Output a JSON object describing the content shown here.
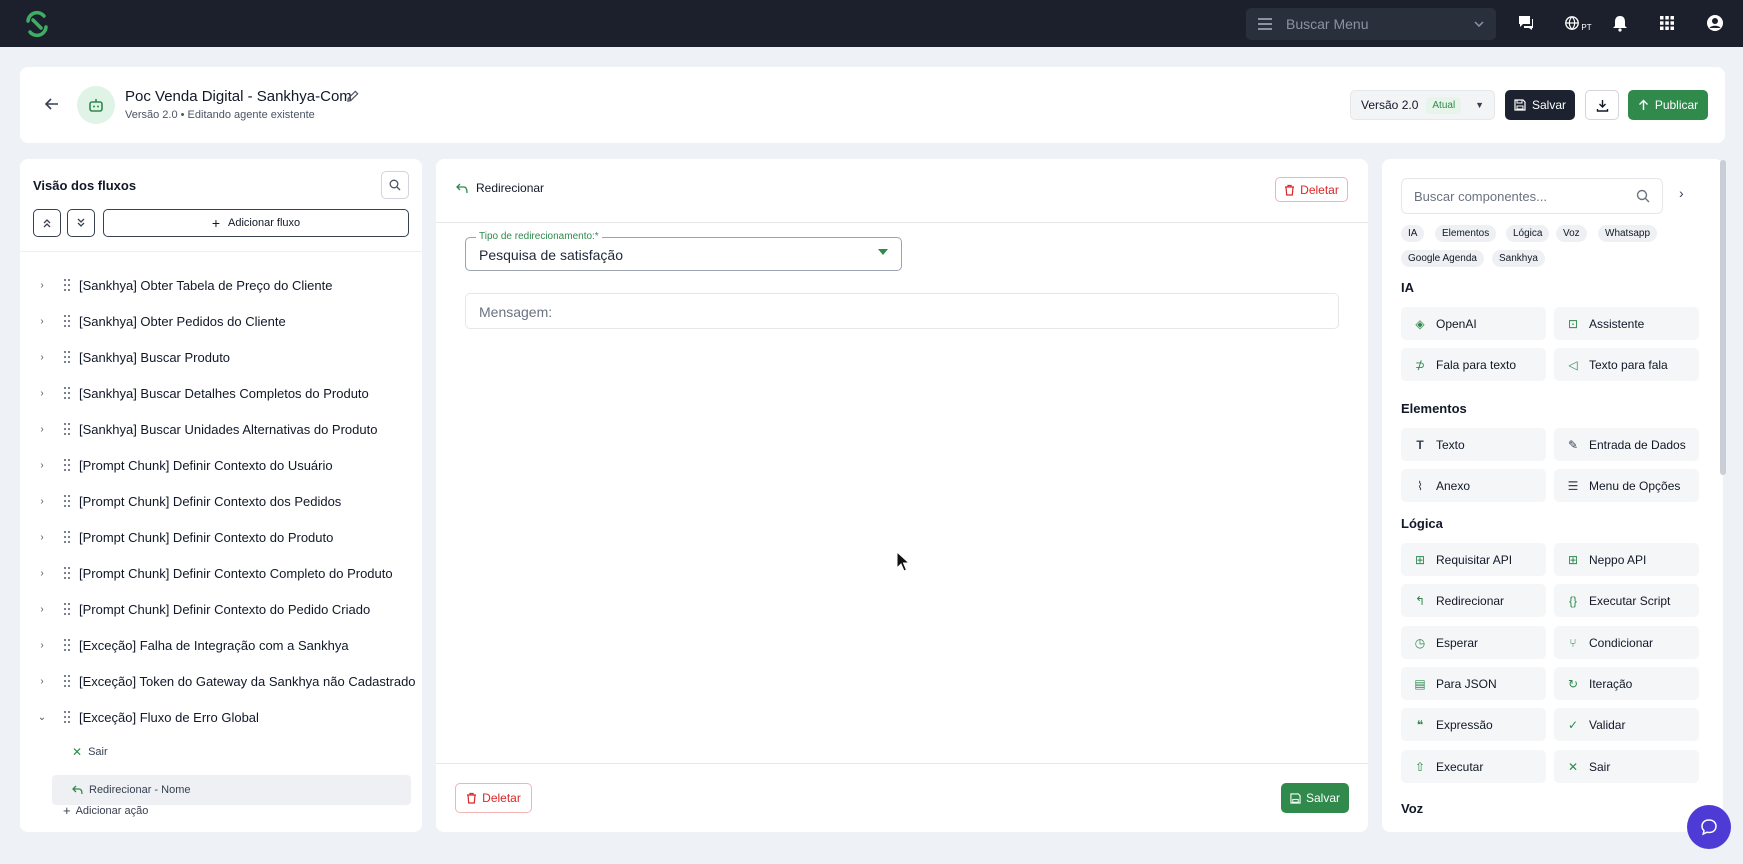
{
  "topbar": {
    "search_placeholder": "Buscar Menu",
    "lang_code": "PT"
  },
  "header": {
    "title": "Poc Venda Digital - Sankhya-Com",
    "subtitle": "Versão 2.0 • Editando agente existente",
    "version_label": "Versão 2.0",
    "version_badge": "Atual",
    "save_label": "Salvar",
    "publish_label": "Publicar"
  },
  "left": {
    "title": "Visão dos fluxos",
    "add_flow_label": "Adicionar fluxo",
    "flows": [
      {
        "label": "[Sankhya] Obter Tabela de Preço do Cliente"
      },
      {
        "label": "[Sankhya] Obter Pedidos do Cliente"
      },
      {
        "label": "[Sankhya] Buscar Produto"
      },
      {
        "label": "[Sankhya] Buscar Detalhes Completos do Produto"
      },
      {
        "label": "[Sankhya] Buscar Unidades Alternativas do Produto"
      },
      {
        "label": "[Prompt Chunk] Definir Contexto do Usuário"
      },
      {
        "label": "[Prompt Chunk] Definir Contexto dos Pedidos"
      },
      {
        "label": "[Prompt Chunk] Definir Contexto do Produto"
      },
      {
        "label": "[Prompt Chunk] Definir Contexto Completo do Produto"
      },
      {
        "label": "[Prompt Chunk] Definir Contexto do Pedido Criado"
      },
      {
        "label": "[Exceção] Falha de Integração com a Sankhya"
      },
      {
        "label": "[Exceção] Token do Gateway da Sankhya não Cadastrado"
      },
      {
        "label": "[Exceção] Fluxo de Erro Global"
      }
    ],
    "sub_items": [
      {
        "label": "Sair"
      },
      {
        "label": "Redirecionar - Nome"
      }
    ],
    "add_action_label": "Adicionar ação"
  },
  "center": {
    "heading": "Redirecionar",
    "delete_label": "Deletar",
    "redirect_type_label": "Tipo de redirecionamento:*",
    "redirect_type_value": "Pesquisa de satisfação",
    "message_placeholder": "Mensagem:",
    "save_label": "Salvar"
  },
  "right": {
    "search_placeholder": "Buscar componentes...",
    "tags": [
      "IA",
      "Elementos",
      "Lógica",
      "Voz",
      "Whatsapp",
      "Google Agenda",
      "Sankhya"
    ],
    "sections": {
      "ia": {
        "title": "IA",
        "items": [
          "OpenAI",
          "Assistente",
          "Fala para texto",
          "Texto para fala"
        ]
      },
      "elementos": {
        "title": "Elementos",
        "items": [
          "Texto",
          "Entrada de Dados",
          "Anexo",
          "Menu de Opções"
        ]
      },
      "logica": {
        "title": "Lógica",
        "items": [
          "Requisitar API",
          "Neppo API",
          "Redirecionar",
          "Executar Script",
          "Esperar",
          "Condicionar",
          "Para JSON",
          "Iteração",
          "Expressão",
          "Validar",
          "Executar",
          "Sair"
        ]
      },
      "voz": {
        "title": "Voz"
      }
    }
  }
}
